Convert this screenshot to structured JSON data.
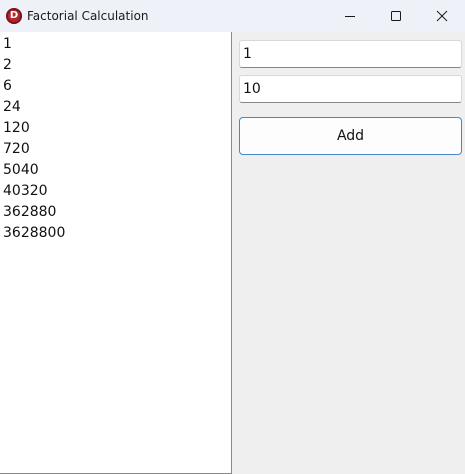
{
  "window": {
    "title": "Factorial Calculation",
    "icon": "d-logo-icon",
    "controls": [
      "minimize-icon",
      "maximize-icon",
      "close-icon"
    ]
  },
  "results": {
    "items": [
      "1",
      "2",
      "6",
      "24",
      "120",
      "720",
      "5040",
      "40320",
      "362880",
      "3628800"
    ]
  },
  "form": {
    "start_value": "1",
    "end_value": "10",
    "add_label": "Add"
  },
  "colors": {
    "titlebar": "#eef2f8",
    "background": "#efefef",
    "button_border": "#4a86c8",
    "app_icon": "#b3262e"
  }
}
